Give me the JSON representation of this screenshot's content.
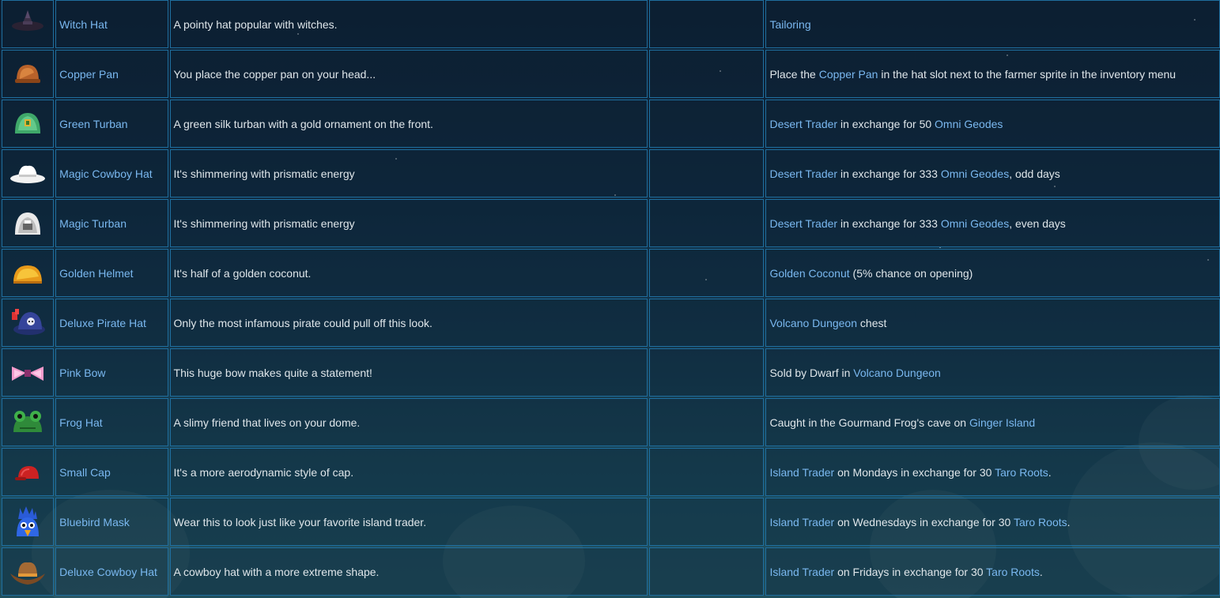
{
  "rows": [
    {
      "name": "Witch Hat",
      "icon": "witch-hat-icon",
      "description": "A pointy hat popular with witches.",
      "obtain": [
        {
          "t": "Tailoring",
          "link": true
        }
      ]
    },
    {
      "name": "Copper Pan",
      "icon": "copper-pan-icon",
      "description": "You place the copper pan on your head...",
      "obtain": [
        {
          "t": "Place the ",
          "link": false
        },
        {
          "t": "Copper Pan",
          "link": true
        },
        {
          "t": " in the hat slot next to the farmer sprite in the inventory menu",
          "link": false
        }
      ]
    },
    {
      "name": "Green Turban",
      "icon": "green-turban-icon",
      "description": "A green silk turban with a gold ornament on the front.",
      "obtain": [
        {
          "t": "Desert Trader",
          "link": true
        },
        {
          "t": " in exchange for 50 ",
          "link": false
        },
        {
          "t": "Omni Geodes",
          "link": true
        }
      ]
    },
    {
      "name": "Magic Cowboy Hat",
      "icon": "magic-cowboy-hat-icon",
      "description": "It's shimmering with prismatic energy",
      "obtain": [
        {
          "t": "Desert Trader",
          "link": true
        },
        {
          "t": " in exchange for 333 ",
          "link": false
        },
        {
          "t": "Omni Geodes",
          "link": true
        },
        {
          "t": ", odd days",
          "link": false
        }
      ]
    },
    {
      "name": "Magic Turban",
      "icon": "magic-turban-icon",
      "description": "It's shimmering with prismatic energy",
      "obtain": [
        {
          "t": "Desert Trader",
          "link": true
        },
        {
          "t": " in exchange for 333 ",
          "link": false
        },
        {
          "t": "Omni Geodes",
          "link": true
        },
        {
          "t": ", even days",
          "link": false
        }
      ]
    },
    {
      "name": "Golden Helmet",
      "icon": "golden-helmet-icon",
      "description": "It's half of a golden coconut.",
      "obtain": [
        {
          "t": "Golden Coconut",
          "link": true
        },
        {
          "t": " (5% chance on opening)",
          "link": false
        }
      ]
    },
    {
      "name": "Deluxe Pirate Hat",
      "icon": "deluxe-pirate-hat-icon",
      "description": "Only the most infamous pirate could pull off this look.",
      "obtain": [
        {
          "t": "Volcano Dungeon",
          "link": true
        },
        {
          "t": " chest",
          "link": false
        }
      ]
    },
    {
      "name": "Pink Bow",
      "icon": "pink-bow-icon",
      "description": "This huge bow makes quite a statement!",
      "obtain": [
        {
          "t": "Sold by Dwarf in ",
          "link": false
        },
        {
          "t": "Volcano Dungeon",
          "link": true
        }
      ]
    },
    {
      "name": "Frog Hat",
      "icon": "frog-hat-icon",
      "description": "A slimy friend that lives on your dome.",
      "obtain": [
        {
          "t": "Caught in the Gourmand Frog's cave on ",
          "link": false
        },
        {
          "t": "Ginger Island",
          "link": true
        }
      ]
    },
    {
      "name": "Small Cap",
      "icon": "small-cap-icon",
      "description": "It's a more aerodynamic style of cap.",
      "obtain": [
        {
          "t": "Island Trader",
          "link": true
        },
        {
          "t": " on Mondays in exchange for 30 ",
          "link": false
        },
        {
          "t": "Taro Roots",
          "link": true
        },
        {
          "t": ".",
          "link": false
        }
      ]
    },
    {
      "name": "Bluebird Mask",
      "icon": "bluebird-mask-icon",
      "description": "Wear this to look just like your favorite island trader.",
      "obtain": [
        {
          "t": "Island Trader",
          "link": true
        },
        {
          "t": " on Wednesdays in exchange for 30 ",
          "link": false
        },
        {
          "t": "Taro Roots",
          "link": true
        },
        {
          "t": ".",
          "link": false
        }
      ]
    },
    {
      "name": "Deluxe Cowboy Hat",
      "icon": "deluxe-cowboy-hat-icon",
      "description": "A cowboy hat with a more extreme shape.",
      "obtain": [
        {
          "t": "Island Trader",
          "link": true
        },
        {
          "t": " on Fridays in exchange for 30 ",
          "link": false
        },
        {
          "t": "Taro Roots",
          "link": true
        },
        {
          "t": ".",
          "link": false
        }
      ]
    }
  ]
}
